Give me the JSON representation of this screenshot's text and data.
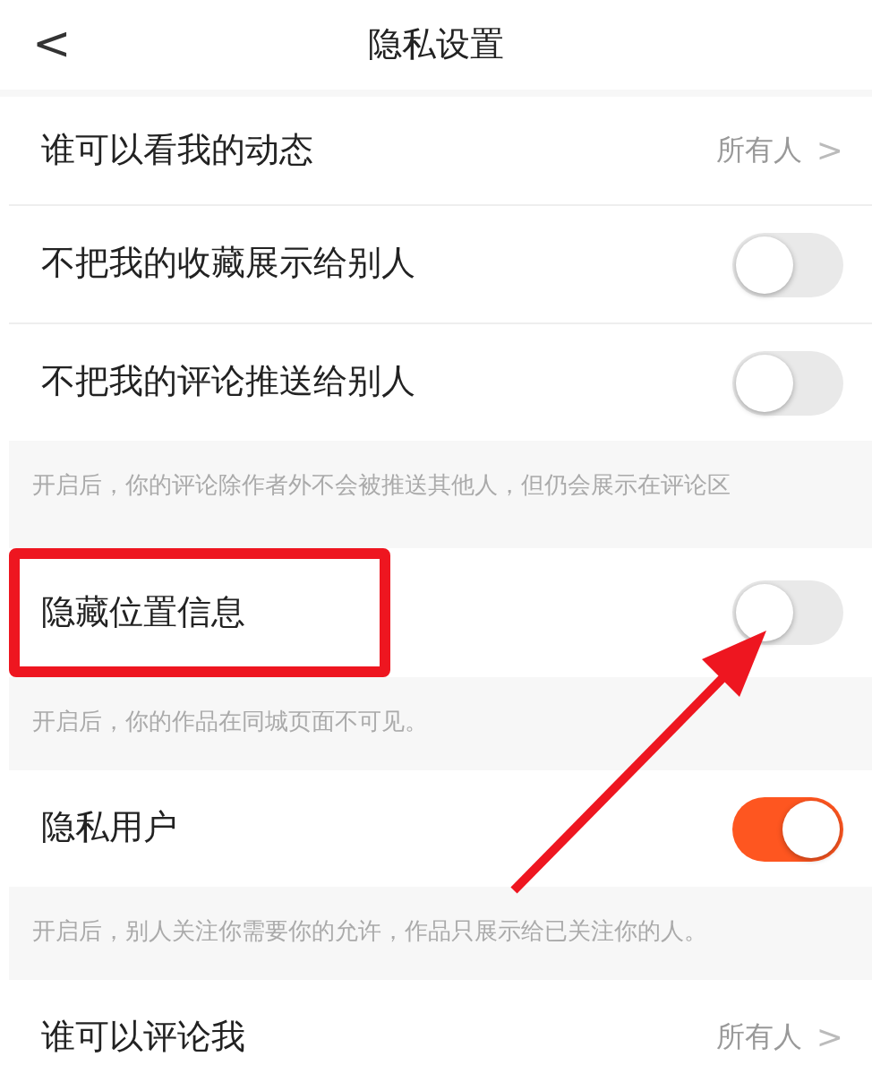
{
  "header": {
    "back": "<",
    "title": "隐私设置"
  },
  "items": [
    {
      "kind": "link",
      "label": "谁可以看我的动态",
      "value": "所有人",
      "chevron": ">",
      "highlighted": false
    },
    {
      "kind": "toggle",
      "label": "不把我的收藏展示给别人",
      "on": false,
      "highlighted": false
    },
    {
      "kind": "toggle",
      "label": "不把我的评论推送给别人",
      "on": false,
      "highlighted": false
    },
    {
      "kind": "hint",
      "text": "开启后，你的评论除作者外不会被推送其他人，但仍会展示在评论区"
    },
    {
      "kind": "toggle",
      "label": "隐藏位置信息",
      "on": false,
      "highlighted": true
    },
    {
      "kind": "hint",
      "text": "开启后，你的作品在同城页面不可见。"
    },
    {
      "kind": "toggle",
      "label": "隐私用户",
      "on": true,
      "highlighted": false
    },
    {
      "kind": "hint",
      "text": "开启后，别人关注你需要你的允许，作品只展示给已关注你的人。"
    },
    {
      "kind": "link",
      "label": "谁可以评论我",
      "value": "所有人",
      "chevron": ">",
      "highlighted": false
    }
  ],
  "annotations": [
    {
      "kind": "arrow"
    }
  ]
}
